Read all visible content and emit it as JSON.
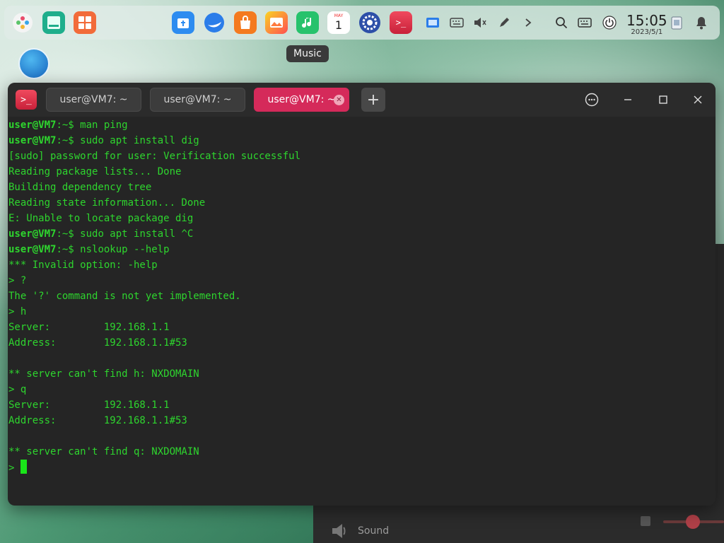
{
  "dock": {
    "tooltip": "Music",
    "apps": [
      "launcher-icon",
      "file-manager-icon",
      "app-store-icon",
      "browser-icon",
      "store-bag-icon",
      "image-viewer-icon",
      "music-icon",
      "calendar-icon",
      "settings-icon",
      "terminal-icon"
    ],
    "calendar_day": "1",
    "calendar_month": "MAY",
    "tray": [
      "screenshot-icon",
      "keyboard-icon",
      "volume-icon",
      "pen-icon",
      "chevron-right-icon",
      "search-icon",
      "onscreen-keyboard-icon",
      "power-icon",
      "trash-icon",
      "notification-icon"
    ]
  },
  "clock": {
    "time": "15:05",
    "date": "2023/5/1"
  },
  "terminal": {
    "tabs": [
      {
        "label": "user@VM7: ~",
        "active": false
      },
      {
        "label": "user@VM7: ~",
        "active": false
      },
      {
        "label": "user@VM7: ~",
        "active": true
      }
    ],
    "prompt_user": "user@VM7",
    "prompt_path": ":~$ ",
    "lines": [
      {
        "type": "prompt",
        "cmd": "man ping"
      },
      {
        "type": "prompt",
        "cmd": "sudo apt install dig"
      },
      {
        "type": "out",
        "text": "[sudo] password for user: Verification successful"
      },
      {
        "type": "out",
        "text": "Reading package lists... Done"
      },
      {
        "type": "out",
        "text": "Building dependency tree"
      },
      {
        "type": "out",
        "text": "Reading state information... Done"
      },
      {
        "type": "out",
        "text": "E: Unable to locate package dig"
      },
      {
        "type": "prompt",
        "cmd": "sudo apt install ^C"
      },
      {
        "type": "prompt",
        "cmd": "nslookup --help"
      },
      {
        "type": "out",
        "text": "*** Invalid option: -help"
      },
      {
        "type": "out",
        "text": "> ?"
      },
      {
        "type": "out",
        "text": "The '?' command is not yet implemented."
      },
      {
        "type": "out",
        "text": "> h"
      },
      {
        "type": "out",
        "text": "Server:         192.168.1.1"
      },
      {
        "type": "out",
        "text": "Address:        192.168.1.1#53"
      },
      {
        "type": "out",
        "text": ""
      },
      {
        "type": "out",
        "text": "** server can't find h: NXDOMAIN"
      },
      {
        "type": "out",
        "text": "> q"
      },
      {
        "type": "out",
        "text": "Server:         192.168.1.1"
      },
      {
        "type": "out",
        "text": "Address:        192.168.1.1#53"
      },
      {
        "type": "out",
        "text": ""
      },
      {
        "type": "out",
        "text": "** server can't find q: NXDOMAIN"
      }
    ],
    "input_prompt": "> "
  },
  "background_window": {
    "sound_label": "Sound"
  },
  "colors": {
    "terminal_text": "#2ed52e",
    "active_tab": "#d52a5a",
    "terminal_bg": "#252525"
  }
}
